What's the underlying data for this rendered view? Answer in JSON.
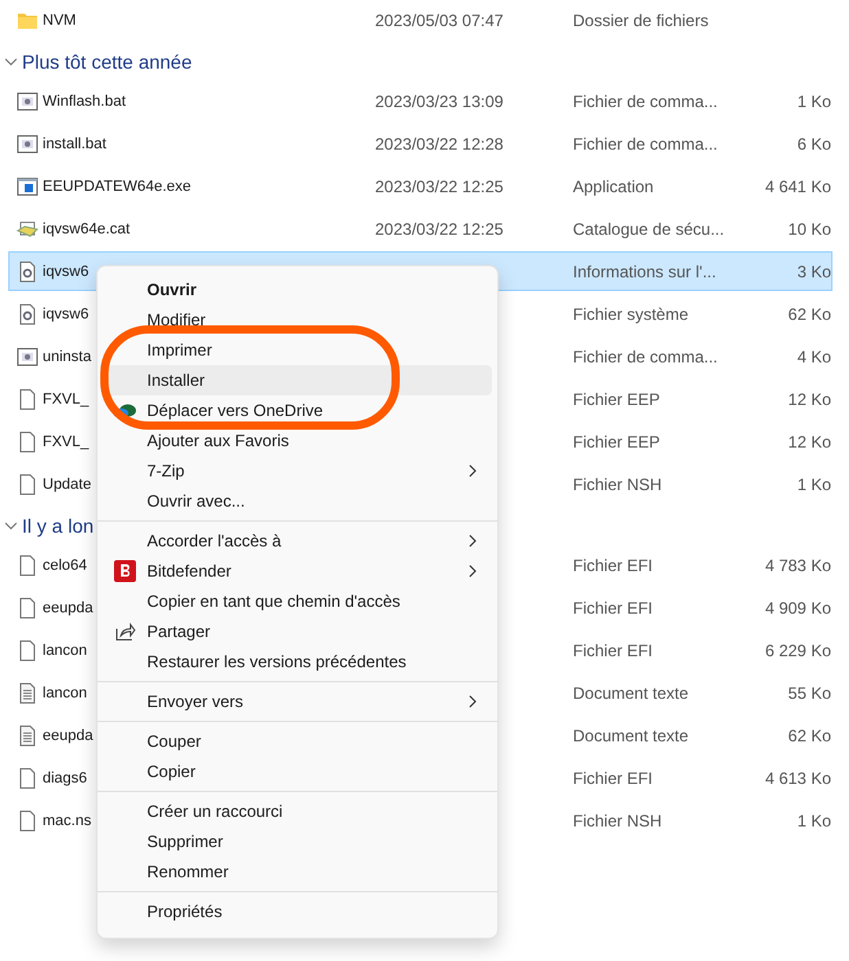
{
  "sections": [
    {
      "rows": [
        {
          "kind": "folder",
          "name": "NVM",
          "date": "2023/05/03 07:47",
          "type": "Dossier de fichiers",
          "selected": false
        }
      ]
    },
    {
      "header": "Plus tôt cette année",
      "expanded": true,
      "rows": [
        {
          "kind": "script",
          "name": "Winflash.bat",
          "date": "2023/03/23 13:09",
          "type": "Fichier de comma...",
          "size": "1 Ko",
          "selected": false
        },
        {
          "kind": "script",
          "name": "install.bat",
          "date": "2023/03/22 12:28",
          "type": "Fichier de comma...",
          "size": "6 Ko",
          "selected": false
        },
        {
          "kind": "app",
          "name": "EEUPDATEW64e.exe",
          "date": "2023/03/22 12:25",
          "type": "Application",
          "size": "4 641 Ko",
          "selected": false
        },
        {
          "kind": "catalog",
          "name": "iqvsw64e.cat",
          "date": "2023/03/22 12:25",
          "type": "Catalogue de sécu...",
          "size": "10 Ko",
          "selected": false
        },
        {
          "kind": "settings",
          "name": "iqvsw6",
          "type": "Informations sur l'...",
          "size": "3 Ko",
          "selected": true
        },
        {
          "kind": "settings",
          "name": "iqvsw6",
          "type": "Fichier système",
          "size": "62 Ko",
          "selected": false
        },
        {
          "kind": "script",
          "name": "uninsta",
          "type": "Fichier de comma...",
          "size": "4 Ko",
          "selected": false
        },
        {
          "kind": "file",
          "name": "FXVL_",
          "type": "Fichier EEP",
          "size": "12 Ko",
          "selected": false
        },
        {
          "kind": "file",
          "name": "FXVL_",
          "type": "Fichier EEP",
          "size": "12 Ko",
          "selected": false
        },
        {
          "kind": "file",
          "name": "Update",
          "type": "Fichier NSH",
          "size": "1 Ko",
          "selected": false
        }
      ]
    },
    {
      "header": "Il y a lon",
      "expanded": true,
      "rows": [
        {
          "kind": "file",
          "name": "celo64",
          "type": "Fichier EFI",
          "size": "4 783 Ko",
          "selected": false
        },
        {
          "kind": "file",
          "name": "eeupda",
          "type": "Fichier EFI",
          "size": "4 909 Ko",
          "selected": false
        },
        {
          "kind": "file",
          "name": "lancon",
          "type": "Fichier EFI",
          "size": "6 229 Ko",
          "selected": false
        },
        {
          "kind": "text",
          "name": "lancon",
          "type": "Document texte",
          "size": "55 Ko",
          "selected": false
        },
        {
          "kind": "text",
          "name": "eeupda",
          "type": "Document texte",
          "size": "62 Ko",
          "selected": false
        },
        {
          "kind": "file",
          "name": "diags6",
          "type": "Fichier EFI",
          "size": "4 613 Ko",
          "selected": false
        },
        {
          "kind": "file",
          "name": "mac.ns",
          "type": "Fichier NSH",
          "size": "1 Ko",
          "selected": false
        }
      ]
    }
  ],
  "context_menu": {
    "groups": [
      [
        {
          "kind": "plain",
          "label": "Ouvrir",
          "default": true,
          "hovered": false,
          "submenu": false
        },
        {
          "kind": "plain",
          "label": "Modifier",
          "default": false,
          "hovered": false,
          "submenu": false
        },
        {
          "kind": "plain",
          "label": "Imprimer",
          "default": false,
          "hovered": false,
          "submenu": false
        },
        {
          "kind": "plain",
          "label": "Installer",
          "default": false,
          "hovered": true,
          "submenu": false
        },
        {
          "kind": "onedrive",
          "label": "Déplacer vers OneDrive",
          "default": false,
          "hovered": false,
          "submenu": false
        },
        {
          "kind": "plain",
          "label": "Ajouter aux Favoris",
          "default": false,
          "hovered": false,
          "submenu": false
        },
        {
          "kind": "plain",
          "label": "7-Zip",
          "default": false,
          "hovered": false,
          "submenu": true
        },
        {
          "kind": "plain",
          "label": "Ouvrir avec...",
          "default": false,
          "hovered": false,
          "submenu": false
        }
      ],
      [
        {
          "kind": "plain",
          "label": "Accorder l'accès à",
          "default": false,
          "hovered": false,
          "submenu": true
        },
        {
          "kind": "bitdefender",
          "label": "Bitdefender",
          "default": false,
          "hovered": false,
          "submenu": true
        },
        {
          "kind": "plain",
          "label": "Copier en tant que chemin d'accès",
          "default": false,
          "hovered": false,
          "submenu": false
        },
        {
          "kind": "share",
          "label": "Partager",
          "default": false,
          "hovered": false,
          "submenu": false
        },
        {
          "kind": "plain",
          "label": "Restaurer les versions précédentes",
          "default": false,
          "hovered": false,
          "submenu": false
        }
      ],
      [
        {
          "kind": "plain",
          "label": "Envoyer vers",
          "default": false,
          "hovered": false,
          "submenu": true
        }
      ],
      [
        {
          "kind": "plain",
          "label": "Couper",
          "default": false,
          "hovered": false,
          "submenu": false
        },
        {
          "kind": "plain",
          "label": "Copier",
          "default": false,
          "hovered": false,
          "submenu": false
        }
      ],
      [
        {
          "kind": "plain",
          "label": "Créer un raccourci",
          "default": false,
          "hovered": false,
          "submenu": false
        },
        {
          "kind": "plain",
          "label": "Supprimer",
          "default": false,
          "hovered": false,
          "submenu": false
        },
        {
          "kind": "plain",
          "label": "Renommer",
          "default": false,
          "hovered": false,
          "submenu": false
        }
      ],
      [
        {
          "kind": "plain",
          "label": "Propriétés",
          "default": false,
          "hovered": false,
          "submenu": false
        }
      ]
    ]
  },
  "annotation": {
    "kind": "ellipse",
    "color": "#ff5a00"
  }
}
